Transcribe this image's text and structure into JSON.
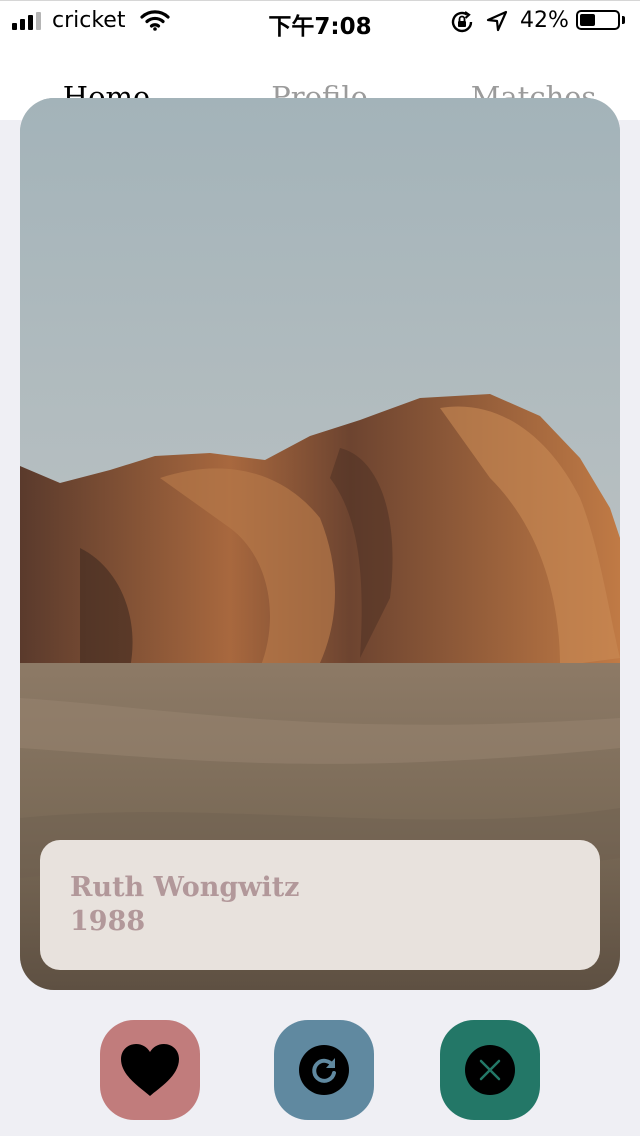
{
  "status_bar": {
    "carrier": "cricket",
    "time": "下午7:08",
    "battery_percent": "42%",
    "battery_level": 0.42,
    "signal_bars": 3,
    "signal_bars_total": 4
  },
  "nav": {
    "tabs": [
      {
        "label": "Home",
        "active": true
      },
      {
        "label": "Profile",
        "active": false
      },
      {
        "label": "Matches",
        "active": false
      }
    ]
  },
  "card": {
    "name": "Ruth Wongwitz",
    "year": "1988",
    "image_subject": "desert-rock-formation-photo"
  },
  "actions": [
    {
      "icon": "heart-icon",
      "color": "#c17c7c"
    },
    {
      "icon": "refresh-icon",
      "color": "#6089a0"
    },
    {
      "icon": "close-icon",
      "color": "#237767"
    }
  ]
}
